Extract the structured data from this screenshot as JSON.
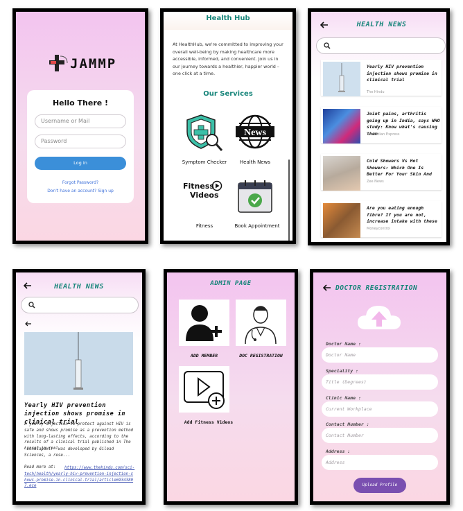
{
  "login": {
    "logo_text": "JAMMP",
    "greeting": "Hello There !",
    "username_placeholder": "Username or Mail",
    "password_placeholder": "Password",
    "login_button": "Log In",
    "forgot_password": "Forgot Password?",
    "signup_prompt": "Don't have an account? Sign up"
  },
  "hub": {
    "title": "Health Hub",
    "intro": "At HealthHub, we're committed to improving your overall well-being by making healthcare more accessible, informed, and convenient. Join us in our journey towards a healthier, happier world – one click at a time.",
    "services_title": "Our Services",
    "services": [
      {
        "label": "Symptom Checker",
        "icon": "shield-search-icon"
      },
      {
        "label": "Health News",
        "icon": "globe-news-icon"
      },
      {
        "label": "Fitness",
        "icon": "fitness-videos-icon",
        "icon_text_1": "Fitness",
        "icon_text_2": "Videos"
      },
      {
        "label": "Book Appointment",
        "icon": "calendar-check-icon"
      }
    ],
    "news_icon_text": "News"
  },
  "news_list": {
    "title": "HEALTH NEWS",
    "search_placeholder": "",
    "articles": [
      {
        "title": "Yearly HIV prevention injection shows promise in clinical trial",
        "source": "The Hindu",
        "thumb": "syringe"
      },
      {
        "title": "Joint pains, arthritis going up in India, says WHO study: Know what's causing them",
        "source": "The Indian Express",
        "thumb": "xray"
      },
      {
        "title": "Cold Showers Vs Hot Showers: Which One Is Better For Your Skin And",
        "source": "Zee News",
        "thumb": "shower"
      },
      {
        "title": "Are you eating enough fibre? If you are not, increase intake with these",
        "source": "Moneycontrol",
        "thumb": "food"
      }
    ]
  },
  "news_detail": {
    "title": "HEALTH NEWS",
    "article_title": "Yearly HIV prevention injection shows promise in clinical trial",
    "body": "A yearly injection to protect against HIV is safe and shows promise as a prevention method with long-lasting effects, according to the results of a clinical trial published in The Lancet journal.",
    "body2": "'Lenacapavir' was developed by Gilead Sciences, a rese...",
    "read_more_label": "Read more at:",
    "read_more_link": "https://www.thehindu.com/sci-tech/health/yearly-hiv-prevention-injection-shows-promise-in-clinical-trial/article69343807.ece"
  },
  "admin": {
    "title": "ADMIN PAGE",
    "tiles": [
      {
        "label": "ADD MEMBER",
        "icon": "add-user-icon"
      },
      {
        "label": "DOC REGISTRATION",
        "icon": "doctor-icon"
      },
      {
        "label": "Add Fitness Videos",
        "icon": "add-video-icon"
      }
    ]
  },
  "doctor": {
    "title": "DOCTOR REGISTRATION",
    "fields": [
      {
        "label": "Doctor Name :",
        "placeholder": "Doctor Name"
      },
      {
        "label": "Speciality :",
        "placeholder": "Title (Degrees)"
      },
      {
        "label": "Clinic Name :",
        "placeholder": "Current Workplace"
      },
      {
        "label": "Contact Number :",
        "placeholder": "Contact Number"
      },
      {
        "label": "Address :",
        "placeholder": "Address"
      }
    ],
    "upload_button": "Upload Profile"
  },
  "colors": {
    "teal": "#17857a",
    "login_button": "#3b8fd9",
    "upload_button": "#7a4fb0",
    "gradient_pink": "#f3c4ef"
  }
}
